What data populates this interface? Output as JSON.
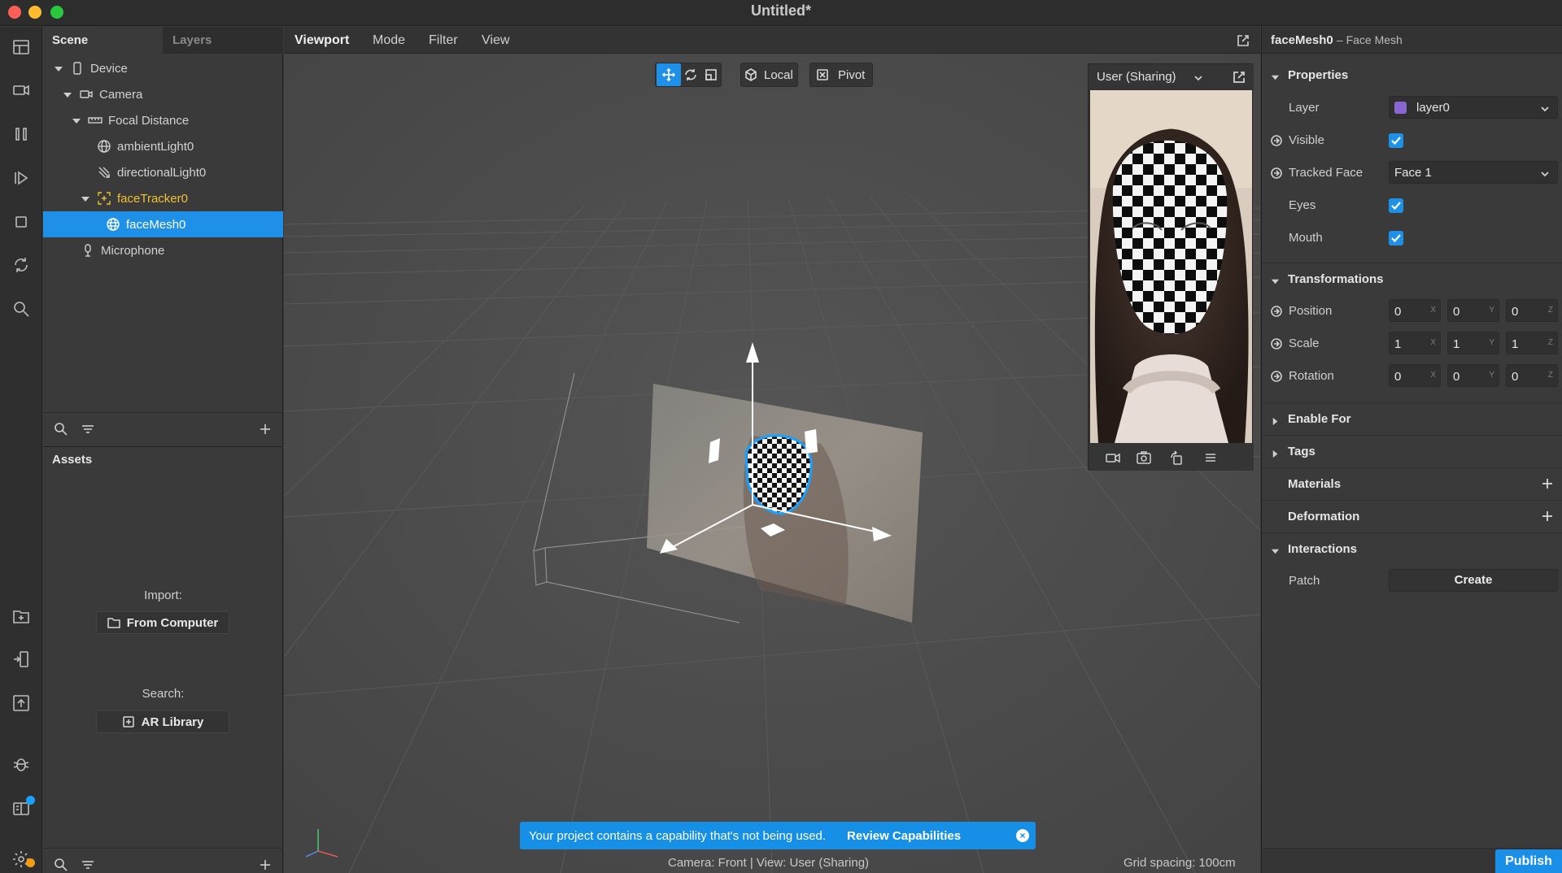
{
  "window": {
    "title": "Untitled*"
  },
  "scene_panel": {
    "tabs": [
      "Scene",
      "Layers"
    ],
    "tree": [
      {
        "label": "Device",
        "icon": "device-icon"
      },
      {
        "label": "Camera",
        "icon": "camera-icon"
      },
      {
        "label": "Focal Distance",
        "icon": "ruler-icon"
      },
      {
        "label": "ambientLight0",
        "icon": "globe-icon"
      },
      {
        "label": "directionalLight0",
        "icon": "directional-light-icon"
      },
      {
        "label": "faceTracker0",
        "icon": "face-tracker-icon",
        "color": "#f1c232"
      },
      {
        "label": "faceMesh0",
        "icon": "mesh-icon",
        "selected": true
      },
      {
        "label": "Microphone",
        "icon": "microphone-icon"
      }
    ]
  },
  "assets_panel": {
    "title": "Assets",
    "import_label": "Import:",
    "from_computer": "From Computer",
    "search_label": "Search:",
    "ar_library": "AR Library"
  },
  "viewport": {
    "menu": [
      "Viewport",
      "Mode",
      "Filter",
      "View"
    ],
    "local_label": "Local",
    "pivot_label": "Pivot",
    "preview_title": "User (Sharing)",
    "banner_message": "Your project contains a capability that's not being used.",
    "banner_action": "Review Capabilities",
    "status_camera": "Camera: Front | View: User (Sharing)",
    "status_grid": "Grid spacing: 100cm"
  },
  "inspector": {
    "object_name": "faceMesh0",
    "object_type": "– Face Mesh",
    "sections": {
      "properties": "Properties",
      "transformations": "Transformations",
      "enable_for": "Enable For",
      "tags": "Tags",
      "materials": "Materials",
      "deformation": "Deformation",
      "interactions": "Interactions"
    },
    "layer": {
      "label": "Layer",
      "value": "layer0",
      "swatch": "#8a66d4"
    },
    "visible": {
      "label": "Visible",
      "checked": true
    },
    "tracked_face": {
      "label": "Tracked Face",
      "value": "Face 1"
    },
    "eyes": {
      "label": "Eyes",
      "checked": true
    },
    "mouth": {
      "label": "Mouth",
      "checked": true
    },
    "position": {
      "label": "Position",
      "x": "0",
      "y": "0",
      "z": "0"
    },
    "scale": {
      "label": "Scale",
      "x": "1",
      "y": "1",
      "z": "1"
    },
    "rotation": {
      "label": "Rotation",
      "x": "0",
      "y": "0",
      "z": "0"
    },
    "axes": [
      "X",
      "Y",
      "Z"
    ],
    "patch": {
      "label": "Patch",
      "button": "Create"
    },
    "publish": "Publish"
  },
  "colors": {
    "accent": "#1e90e8",
    "tracker": "#f1c232",
    "banner": "#1590e6"
  }
}
